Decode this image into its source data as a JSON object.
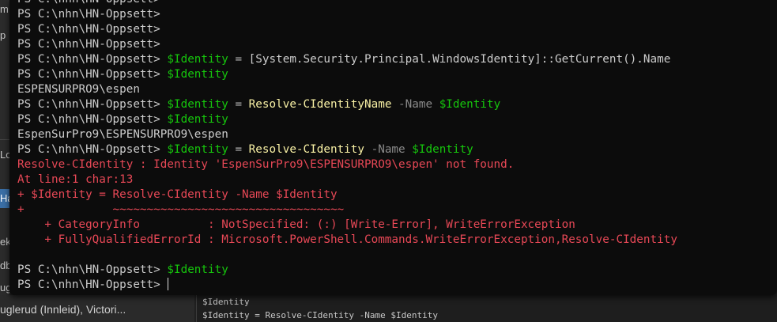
{
  "background_app": {
    "left_fragments": [
      "m",
      "p",
      "Lo",
      "Ha",
      "ek",
      "db",
      "ug"
    ],
    "bottom_left_text": "uglerud (Innleid), Victori...",
    "bottom_right_history": [
      "$Identity",
      "$Identity = Resolve-CIdentity -Name $Identity"
    ]
  },
  "terminal": {
    "lines": [
      {
        "kind": "prompt",
        "prompt": "PS C:\\nhn\\HN-Oppsett> ",
        "tokens": []
      },
      {
        "kind": "prompt",
        "prompt": "PS C:\\nhn\\HN-Oppsett> ",
        "tokens": []
      },
      {
        "kind": "prompt",
        "prompt": "PS C:\\nhn\\HN-Oppsett> ",
        "tokens": []
      },
      {
        "kind": "prompt",
        "prompt": "PS C:\\nhn\\HN-Oppsett> ",
        "tokens": []
      },
      {
        "kind": "prompt",
        "prompt": "PS C:\\nhn\\HN-Oppsett> ",
        "tokens": [
          {
            "cls": "var",
            "text": "$Identity"
          },
          {
            "cls": "op",
            "text": " = "
          },
          {
            "cls": "type",
            "text": "[System.Security.Principal.WindowsIdentity]::GetCurrent().Name"
          }
        ]
      },
      {
        "kind": "prompt",
        "prompt": "PS C:\\nhn\\HN-Oppsett> ",
        "tokens": [
          {
            "cls": "var",
            "text": "$Identity"
          }
        ]
      },
      {
        "kind": "output",
        "text": "ESPENSURPRO9\\espen"
      },
      {
        "kind": "prompt",
        "prompt": "PS C:\\nhn\\HN-Oppsett> ",
        "tokens": [
          {
            "cls": "var",
            "text": "$Identity"
          },
          {
            "cls": "op",
            "text": " = "
          },
          {
            "cls": "cmd",
            "text": "Resolve-CIdentityName"
          },
          {
            "cls": "param",
            "text": " -Name "
          },
          {
            "cls": "var",
            "text": "$Identity"
          }
        ]
      },
      {
        "kind": "prompt",
        "prompt": "PS C:\\nhn\\HN-Oppsett> ",
        "tokens": [
          {
            "cls": "var",
            "text": "$Identity"
          }
        ]
      },
      {
        "kind": "output",
        "text": "EspenSurPro9\\ESPENSURPRO9\\espen"
      },
      {
        "kind": "prompt",
        "prompt": "PS C:\\nhn\\HN-Oppsett> ",
        "tokens": [
          {
            "cls": "var",
            "text": "$Identity"
          },
          {
            "cls": "op",
            "text": " = "
          },
          {
            "cls": "cmd",
            "text": "Resolve-CIdentity"
          },
          {
            "cls": "param",
            "text": " -Name "
          },
          {
            "cls": "var",
            "text": "$Identity"
          }
        ]
      },
      {
        "kind": "error",
        "text": "Resolve-CIdentity : Identity 'EspenSurPro9\\ESPENSURPRO9\\espen' not found."
      },
      {
        "kind": "error",
        "text": "At line:1 char:13"
      },
      {
        "kind": "error",
        "text": "+ $Identity = Resolve-CIdentity -Name $Identity"
      },
      {
        "kind": "error",
        "text": "+             ~~~~~~~~~~~~~~~~~~~~~~~~~~~~~~~~~~"
      },
      {
        "kind": "error",
        "text": "    + CategoryInfo          : NotSpecified: (:) [Write-Error], WriteErrorException"
      },
      {
        "kind": "error",
        "text": "    + FullyQualifiedErrorId : Microsoft.PowerShell.Commands.WriteErrorException,Resolve-CIdentity"
      },
      {
        "kind": "blank",
        "text": ""
      },
      {
        "kind": "prompt",
        "prompt": "PS C:\\nhn\\HN-Oppsett> ",
        "tokens": [
          {
            "cls": "var",
            "text": "$Identity"
          }
        ]
      },
      {
        "kind": "prompt",
        "prompt": "PS C:\\nhn\\HN-Oppsett> ",
        "tokens": [],
        "cursor": true
      }
    ]
  },
  "colors": {
    "terminal_bg": "#0c0c0c",
    "text": "#cccccc",
    "variable": "#16c60c",
    "command": "#f9f1a5",
    "parameter": "#8a8a8a",
    "error": "#e74856"
  }
}
